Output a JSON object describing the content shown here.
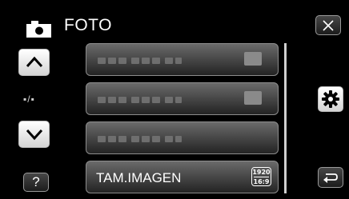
{
  "header": {
    "title": "FOTO",
    "mode_icon": "camera-icon"
  },
  "nav": {
    "up_icon": "chevron-up-icon",
    "down_icon": "chevron-down-icon",
    "page_indicator": "▪/▪",
    "help_label": "?"
  },
  "controls": {
    "close_icon": "close-icon",
    "settings_icon": "gear-icon",
    "back_icon": "return-icon"
  },
  "menu": {
    "items": [
      {
        "label": "",
        "placeholder": true
      },
      {
        "label": "",
        "placeholder": true
      },
      {
        "label": "",
        "placeholder": true
      },
      {
        "label": "TAM.IMAGEN",
        "value_icon": {
          "top": "1920",
          "bottom": "16:9"
        }
      }
    ]
  },
  "colors": {
    "background": "#000000",
    "button_text": "#ffffff",
    "light_button": "#ffffff"
  }
}
